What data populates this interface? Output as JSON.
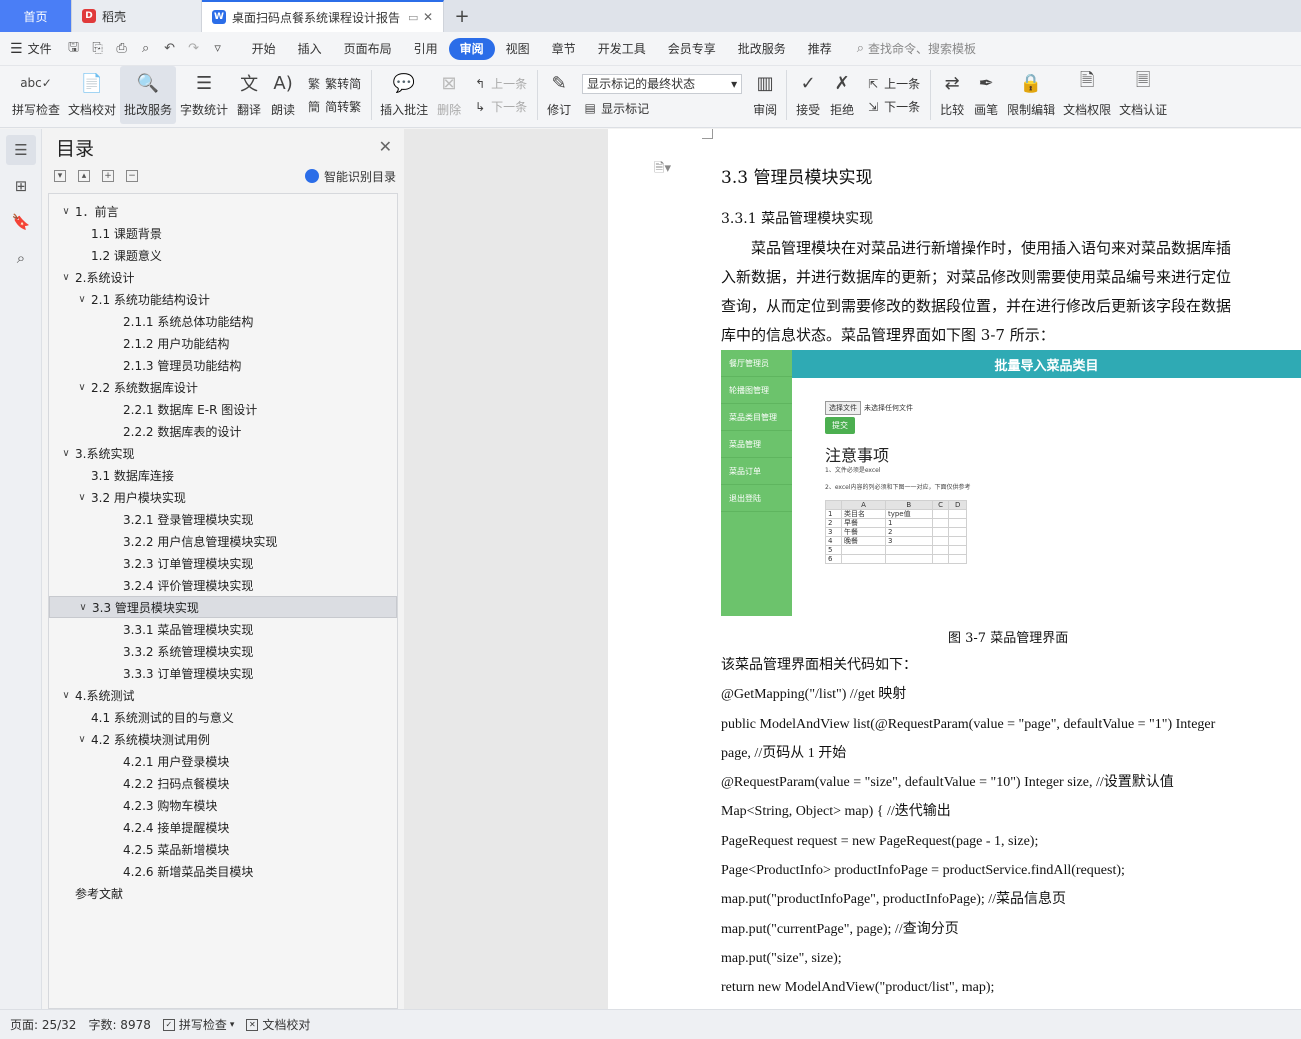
{
  "tabs": {
    "home": "首页",
    "daoke": "稻壳",
    "doc": "桌面扫码点餐系统课程设计报告",
    "new_tab": "+"
  },
  "menu": {
    "file": "文件",
    "items": [
      "开始",
      "插入",
      "页面布局",
      "引用",
      "审阅",
      "视图",
      "章节",
      "开发工具",
      "会员专享",
      "批改服务",
      "推荐"
    ],
    "active": "审阅",
    "search": "查找命令、搜索模板"
  },
  "ribbon": {
    "spell": "拼写检查",
    "doc_check": "文档校对",
    "review_service": "批改服务",
    "word_count": "字数统计",
    "translate": "翻译",
    "read": "朗读",
    "trad": "繁转简",
    "simp": "简转繁",
    "insert_comment": "插入批注",
    "delete": "删除",
    "prev": "上一条",
    "next": "下一条",
    "track": "修订",
    "markup_select": "显示标记的最终状态",
    "show_markup": "显示标记",
    "review": "审阅",
    "accept": "接受",
    "reject": "拒绝",
    "prev2": "上一条",
    "next2": "下一条",
    "compare": "比较",
    "pen": "画笔",
    "restrict": "限制编辑",
    "permission": "文档权限",
    "certify": "文档认证"
  },
  "toc": {
    "title": "目录",
    "smart": "智能识别目录",
    "items": [
      {
        "text": "1．前言",
        "level": 1,
        "chev": true
      },
      {
        "text": "1.1  课题背景",
        "level": 2,
        "chev": false
      },
      {
        "text": "1.2  课题意义",
        "level": 2,
        "chev": false
      },
      {
        "text": "2.系统设计",
        "level": 1,
        "chev": true
      },
      {
        "text": "2.1 系统功能结构设计",
        "level": 2,
        "chev": true
      },
      {
        "text": "2.1.1  系统总体功能结构",
        "level": 3,
        "chev": false
      },
      {
        "text": "2.1.2  用户功能结构",
        "level": 3,
        "chev": false
      },
      {
        "text": "2.1.3  管理员功能结构",
        "level": 3,
        "chev": false
      },
      {
        "text": "2.2  系统数据库设计",
        "level": 2,
        "chev": true
      },
      {
        "text": "2.2.1  数据库 E-R 图设计",
        "level": 3,
        "chev": false
      },
      {
        "text": "2.2.2  数据库表的设计",
        "level": 3,
        "chev": false
      },
      {
        "text": "3.系统实现",
        "level": 1,
        "chev": true
      },
      {
        "text": "3.1 数据库连接",
        "level": 2,
        "chev": false
      },
      {
        "text": "3.2 用户模块实现",
        "level": 2,
        "chev": true
      },
      {
        "text": "3.2.1  登录管理模块实现",
        "level": 3,
        "chev": false
      },
      {
        "text": "3.2.2  用户信息管理模块实现",
        "level": 3,
        "chev": false
      },
      {
        "text": "3.2.3  订单管理模块实现",
        "level": 3,
        "chev": false
      },
      {
        "text": "3.2.4  评价管理模块实现",
        "level": 3,
        "chev": false
      },
      {
        "text": "3.3  管理员模块实现",
        "level": 2,
        "chev": true,
        "selected": true
      },
      {
        "text": "3.3.1  菜品管理模块实现",
        "level": 3,
        "chev": false
      },
      {
        "text": "3.3.2  系统管理模块实现",
        "level": 3,
        "chev": false
      },
      {
        "text": "3.3.3  订单管理模块实现",
        "level": 3,
        "chev": false
      },
      {
        "text": "4.系统测试",
        "level": 1,
        "chev": true
      },
      {
        "text": "4.1 系统测试的目的与意义",
        "level": 2,
        "chev": false
      },
      {
        "text": "4.2  系统模块测试用例",
        "level": 2,
        "chev": true
      },
      {
        "text": "4.2.1  用户登录模块",
        "level": 3,
        "chev": false
      },
      {
        "text": "4.2.2  扫码点餐模块",
        "level": 3,
        "chev": false
      },
      {
        "text": "4.2.3  购物车模块",
        "level": 3,
        "chev": false
      },
      {
        "text": "4.2.4  接单提醒模块",
        "level": 3,
        "chev": false
      },
      {
        "text": "4.2.5  菜品新增模块",
        "level": 3,
        "chev": false
      },
      {
        "text": "4.2.6  新增菜品类目模块",
        "level": 3,
        "chev": false
      },
      {
        "text": "参考文献",
        "level": 1,
        "chev": false
      }
    ]
  },
  "doc": {
    "h2": "3.3  管理员模块实现",
    "h3": "3.3.1  菜品管理模块实现",
    "para_lines": [
      "菜品管理模块在对菜品进行新增操作时，使用插入语句来对菜品数据库插",
      "入新数据，并进行数据库的更新；对菜品修改则需要使用菜品编号来进行定位",
      "查询，从而定位到需要修改的数据段位置，并在进行修改后更新该字段在数据",
      "库中的信息状态。菜品管理界面如下图 3-7 所示："
    ],
    "shot": {
      "sidebar": [
        "餐厅管理员",
        "轮播图管理",
        "菜品类目管理",
        "菜品管理",
        "菜品订单",
        "退出登陆"
      ],
      "header": "批量导入菜品类目",
      "file_btn": "选择文件",
      "file_none": "未选择任何文件",
      "submit": "提交",
      "title": "注意事项",
      "note1": "1、文件必须是excel",
      "note2": "2、excel内容的列必须和下图一一对应，下面仅供参考",
      "table_header": [
        "",
        "A",
        "B",
        "C",
        "D"
      ],
      "table_rows": [
        [
          "1",
          "类目名",
          "type值",
          "",
          ""
        ],
        [
          "2",
          "早餐",
          "1",
          "",
          ""
        ],
        [
          "3",
          "午餐",
          "2",
          "",
          ""
        ],
        [
          "4",
          "晚餐",
          "3",
          "",
          ""
        ],
        [
          "5",
          "",
          "",
          "",
          ""
        ],
        [
          "6",
          "",
          "",
          "",
          ""
        ]
      ]
    },
    "caption": "图 3-7  菜品管理界面",
    "code_lines": [
      "该菜品管理界面相关代码如下：",
      "@GetMapping(\"/list\")     //get 映射",
      "public ModelAndView list(@RequestParam(value = \"page\", defaultValue = \"1\") Integer",
      "page,    //页码从 1 开始",
      "@RequestParam(value = \"size\", defaultValue = \"10\") Integer size,    //设置默认值",
      "Map<String, Object> map) {    //迭代输出",
      "PageRequest request = new PageRequest(page - 1, size);",
      "Page<ProductInfo> productInfoPage = productService.findAll(request);",
      "map.put(\"productInfoPage\", productInfoPage);        //菜品信息页",
      "map.put(\"currentPage\", page);    //查询分页",
      "map.put(\"size\", size);",
      "return new ModelAndView(\"product/list\", map);"
    ]
  },
  "status": {
    "page": "页面: 25/32",
    "words": "字数: 8978",
    "spell": "拼写检查",
    "proof": "文档校对"
  }
}
